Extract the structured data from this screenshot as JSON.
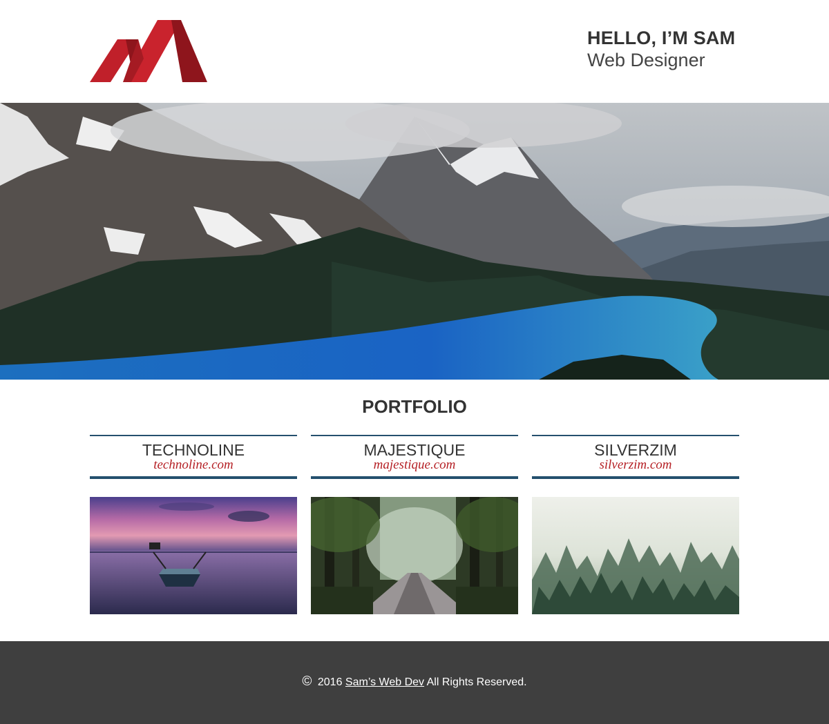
{
  "header": {
    "title": "HELLO, I’M SAM",
    "subtitle": "Web Designer",
    "logo_color": "#c0202a"
  },
  "hero": {
    "image": "mountain-lake-icon"
  },
  "portfolio": {
    "title": "PORTFOLIO",
    "accent_color": "#24506e",
    "items": [
      {
        "name": "TECHNOLINE",
        "url": "technoline.com",
        "image": "boat-sunset-icon"
      },
      {
        "name": "MAJESTIQUE",
        "url": "majestique.com",
        "image": "forest-road-icon"
      },
      {
        "name": "SILVERZIM",
        "url": "silverzim.com",
        "image": "foggy-forest-icon"
      }
    ]
  },
  "footer": {
    "symbol": "©",
    "year": "2016",
    "link_text": "Sam’s Web Dev",
    "suffix": "All Rights Reserved.",
    "background": "#3f3f3f"
  }
}
